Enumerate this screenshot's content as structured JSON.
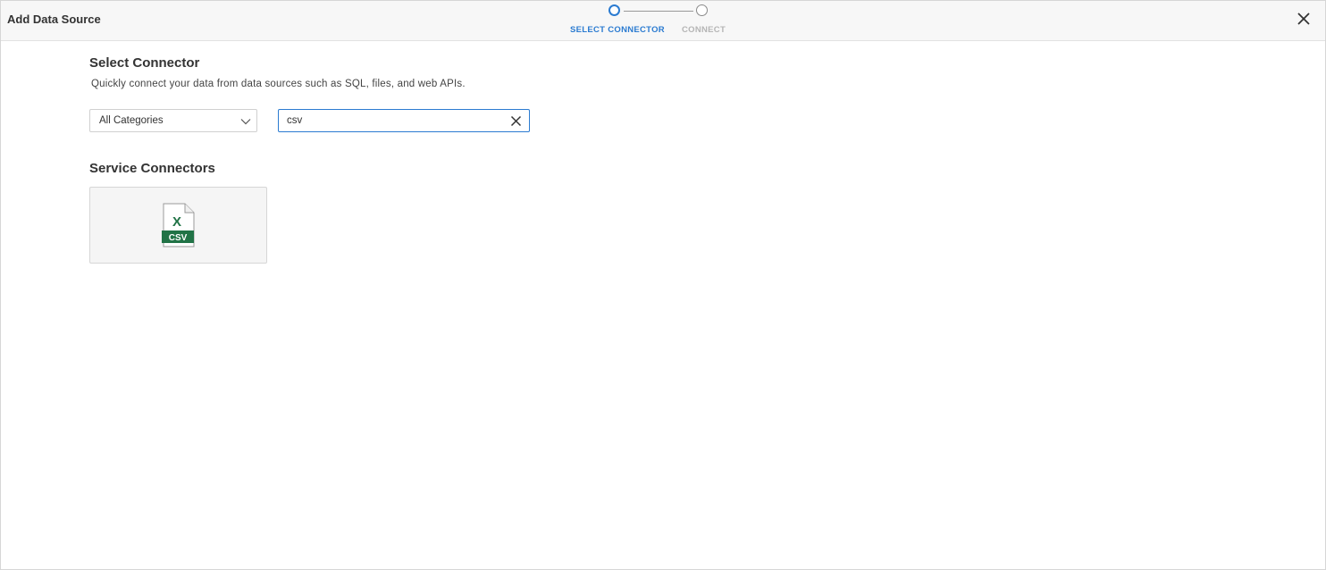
{
  "dialog": {
    "title": "Add Data Source"
  },
  "stepper": {
    "steps": [
      {
        "label": "SELECT CONNECTOR",
        "state": "active"
      },
      {
        "label": "CONNECT",
        "state": "inactive"
      }
    ],
    "active_color": "#2b7bd1"
  },
  "main": {
    "title": "Select Connector",
    "description": "Quickly connect your data from data sources such as SQL, files, and web APIs.",
    "category_select": {
      "value": "All Categories",
      "icon": "chevron-down-icon"
    },
    "search": {
      "value": "csv",
      "clear_icon": "close-icon"
    },
    "section": {
      "title": "Service Connectors",
      "connectors": [
        {
          "icon": "csv-file-icon",
          "icon_text": "CSV",
          "icon_letter": "X",
          "color": "#217346"
        }
      ]
    }
  },
  "icons": {
    "close": "close-icon"
  }
}
